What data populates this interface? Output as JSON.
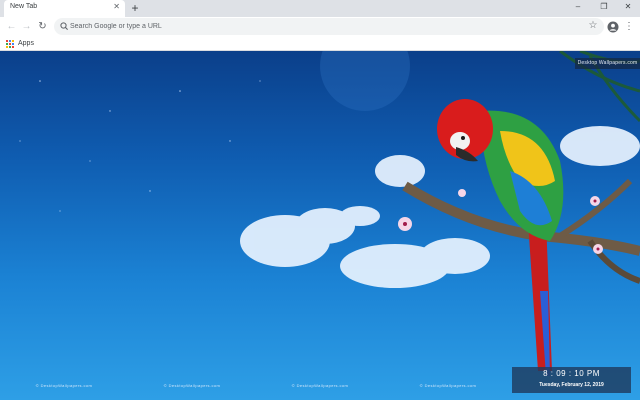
{
  "tab": {
    "title": "New Tab",
    "close_symbol": "✕"
  },
  "new_tab_symbol": "+",
  "window_controls": {
    "minimize": "–",
    "restore": "❐",
    "close": "✕"
  },
  "toolbar": {
    "back_symbol": "←",
    "forward_symbol": "→",
    "reload_symbol": "↻",
    "omnibox_placeholder": "Search Google or type a URL",
    "star_symbol": "☆",
    "menu_symbol": "⋮"
  },
  "bookmarks": {
    "apps_label": "Apps"
  },
  "wallpaper": {
    "watermark_top": "Desktop Wallpapers.com",
    "footer_marks": [
      "© DesktopWallpapers.com",
      "© DesktopWallpapers.com",
      "© DesktopWallpapers.com",
      "© DesktopWallpapers.com",
      "© DesktopWallpapers.com"
    ],
    "clock_time": "8 : 09 : 10  PM",
    "clock_date": "Tuesday, February 12, 2019"
  },
  "colors": {
    "tab_bg": "#ffffff",
    "strip_bg": "#dee1e6",
    "omnibox_bg": "#f1f3f4",
    "sky_top": "#0b3f8a",
    "sky_bottom": "#2e9fe6"
  }
}
